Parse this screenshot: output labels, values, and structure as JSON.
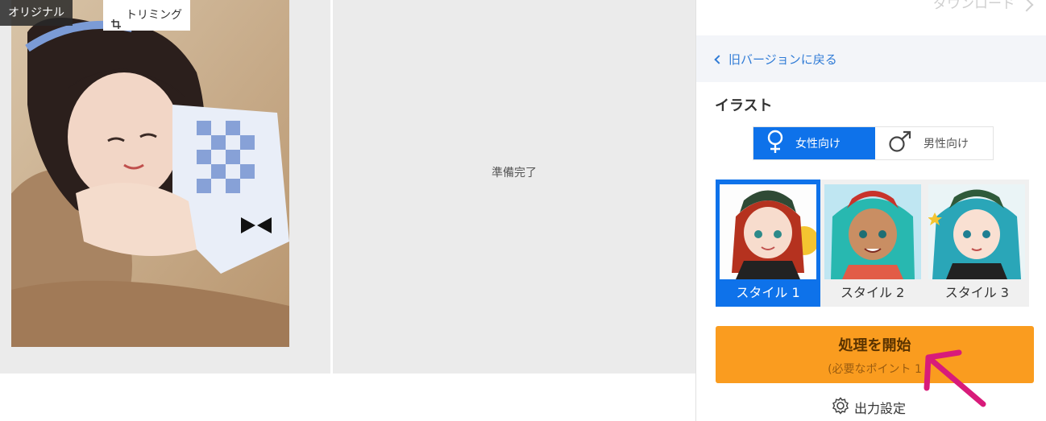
{
  "left": {
    "badge_original": "オリジナル",
    "trim_label": "トリミング",
    "status": "準備完了"
  },
  "panel": {
    "download_label": "ダウンロード",
    "back_label": "旧バージョンに戻る",
    "section_title": "イラスト",
    "gender_options": [
      {
        "label": "女性向け",
        "selected": true,
        "icon": "female-icon"
      },
      {
        "label": "男性向け",
        "selected": false,
        "icon": "male-icon"
      }
    ],
    "styles": [
      {
        "label": "スタイル 1",
        "selected": true
      },
      {
        "label": "スタイル 2",
        "selected": false
      },
      {
        "label": "スタイル 3",
        "selected": false
      }
    ],
    "start_button": {
      "label": "処理を開始",
      "sub": "(必要なポイント 1"
    },
    "output_settings": "出力設定"
  },
  "colors": {
    "accent_blue": "#0e72ea",
    "start_orange": "#fa9c1f",
    "link_blue": "#2f7bd6",
    "annotation_arrow": "#d81b7a"
  }
}
